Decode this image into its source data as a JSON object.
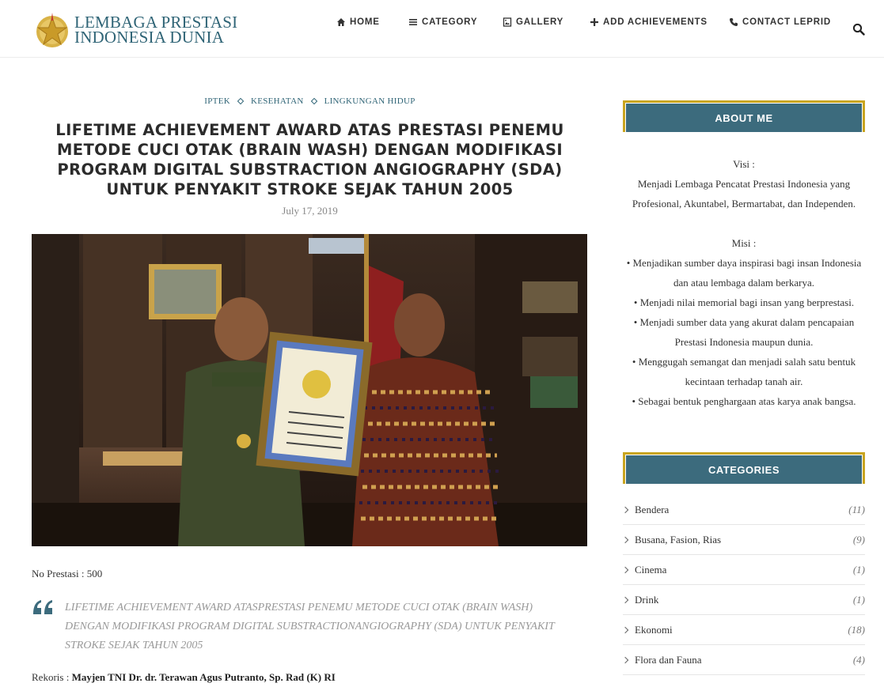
{
  "header": {
    "logo_line1": "LEMBAGA PRESTASI",
    "logo_line2": "INDONESIA DUNIA",
    "nav": [
      {
        "label": "HOME",
        "icon": "home-icon"
      },
      {
        "label": "CATEGORY",
        "icon": "menu-icon"
      },
      {
        "label": "GALLERY",
        "icon": "image-icon"
      },
      {
        "label": "ADD ACHIEVEMENTS",
        "icon": "plus-icon"
      },
      {
        "label": "CONTACT LEPRID",
        "icon": "phone-icon"
      }
    ],
    "search_icon": "search-icon"
  },
  "post": {
    "categories": [
      "IPTEK",
      "KESEHATAN",
      "LINGKUNGAN HIDUP"
    ],
    "title": "LIFETIME ACHIEVEMENT AWARD ATAS PRESTASI PENEMU METODE CUCI OTAK (BRAIN WASH) DENGAN MODIFIKASI PROGRAM DIGITAL SUBSTRACTION ANGIOGRAPHY (SDA) UNTUK PENYAKIT STROKE SEJAK TAHUN 2005",
    "date": "July 17, 2019",
    "no_prestasi": "No Prestasi : 500",
    "quote": "LIFETIME ACHIEVEMENT AWARD ATASPRESTASI PENEMU METODE CUCI OTAK (BRAIN WASH) DENGAN MODIFIKASI PROGRAM DIGITAl SUBSTRACTIONANGIOGRAPHY (SDA) UNTUK PENYAKIT STROKE SEJAK TAHUN 2005",
    "rekoris_label": "Rekoris : ",
    "rekoris_name": "Mayjen TNI Dr. dr. Terawan Agus Putranto, Sp. Rad (K) RI"
  },
  "sidebar": {
    "about_title": "ABOUT ME",
    "visi_label": "Visi :",
    "visi_text": "Menjadi Lembaga Pencatat Prestasi Indonesia yang Profesional, Akuntabel, Bermartabat, dan Independen.",
    "misi_label": "Misi :",
    "misi_items": [
      "• Menjadikan sumber daya inspirasi bagi insan Indonesia dan atau lembaga dalam berkarya.",
      "• Menjadi nilai memorial bagi insan yang berprestasi.",
      "• Menjadi sumber data yang akurat dalam pencapaian Prestasi Indonesia maupun dunia.",
      "• Menggugah semangat dan menjadi salah satu bentuk kecintaan terhadap tanah air.",
      "• Sebagai bentuk penghargaan atas karya anak bangsa."
    ],
    "categories_title": "CATEGORIES",
    "categories": [
      {
        "name": "Bendera",
        "count": "(11)"
      },
      {
        "name": "Busana, Fasion, Rias",
        "count": "(9)"
      },
      {
        "name": "Cinema",
        "count": "(1)"
      },
      {
        "name": "Drink",
        "count": "(1)"
      },
      {
        "name": "Ekonomi",
        "count": "(18)"
      },
      {
        "name": "Flora dan Fauna",
        "count": "(4)"
      }
    ]
  },
  "colors": {
    "accent": "#3c6b7d",
    "gold": "#c9a520",
    "link": "#2f6476"
  }
}
